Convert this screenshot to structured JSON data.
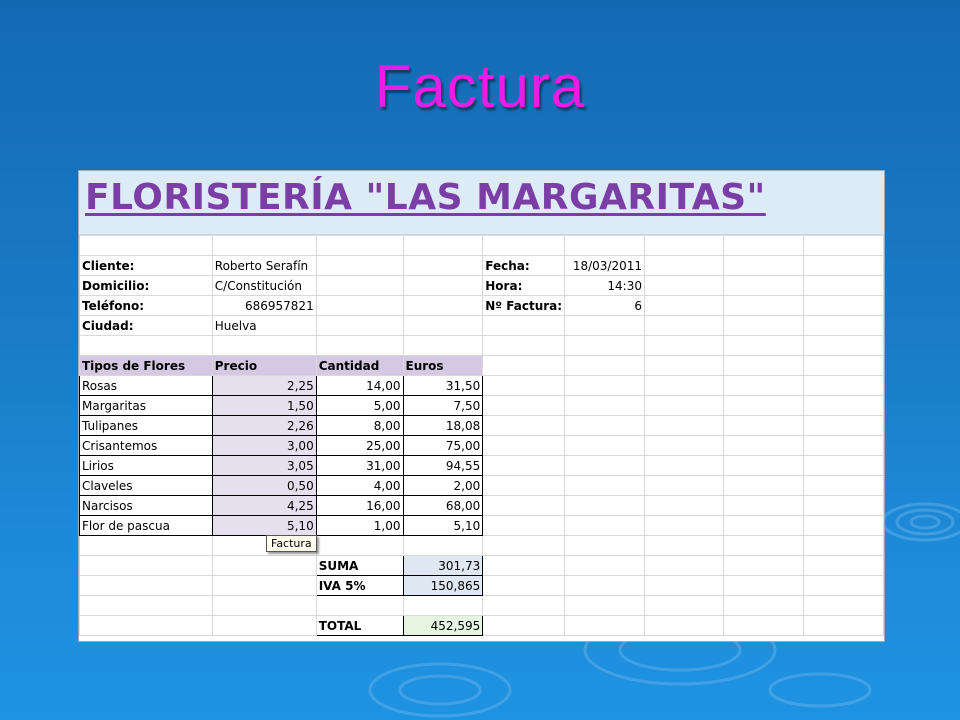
{
  "slide": {
    "title": "Factura"
  },
  "sheet": {
    "shop_name": "FLORISTERÍA \"LAS MARGARITAS\"",
    "client": {
      "cliente_label": "Cliente:",
      "cliente_value": "Roberto Serafín",
      "domicilio_label": "Domicilio:",
      "domicilio_value": "C/Constitución",
      "telefono_label": "Teléfono:",
      "telefono_value": "686957821",
      "ciudad_label": "Ciudad:",
      "ciudad_value": "Huelva"
    },
    "invoice": {
      "fecha_label": "Fecha:",
      "fecha_value": "18/03/2011",
      "hora_label": "Hora:",
      "hora_value": "14:30",
      "numero_label": "Nº Factura:",
      "numero_value": "6"
    },
    "table": {
      "headers": [
        "Tipos de Flores",
        "Precio",
        "Cantidad",
        "Euros"
      ],
      "rows": [
        [
          "Rosas",
          "2,25",
          "14,00",
          "31,50"
        ],
        [
          "Margaritas",
          "1,50",
          "5,00",
          "7,50"
        ],
        [
          "Tulipanes",
          "2,26",
          "8,00",
          "18,08"
        ],
        [
          "Crisantemos",
          "3,00",
          "25,00",
          "75,00"
        ],
        [
          "Lirios",
          "3,05",
          "31,00",
          "94,55"
        ],
        [
          "Claveles",
          "0,50",
          "4,00",
          "2,00"
        ],
        [
          "Narcisos",
          "4,25",
          "16,00",
          "68,00"
        ],
        [
          "Flor de pascua",
          "5,10",
          "1,00",
          "5,10"
        ]
      ]
    },
    "totals": {
      "suma_label": "SUMA",
      "suma_value": "301,73",
      "iva_label": "IVA 5%",
      "iva_value": "150,865",
      "total_label": "TOTAL",
      "total_value": "452,595"
    },
    "tooltip": "Factura"
  },
  "colors": {
    "title": "#e61ee6",
    "shop_name": "#7b3ea6",
    "background": "#1a7bc6"
  }
}
